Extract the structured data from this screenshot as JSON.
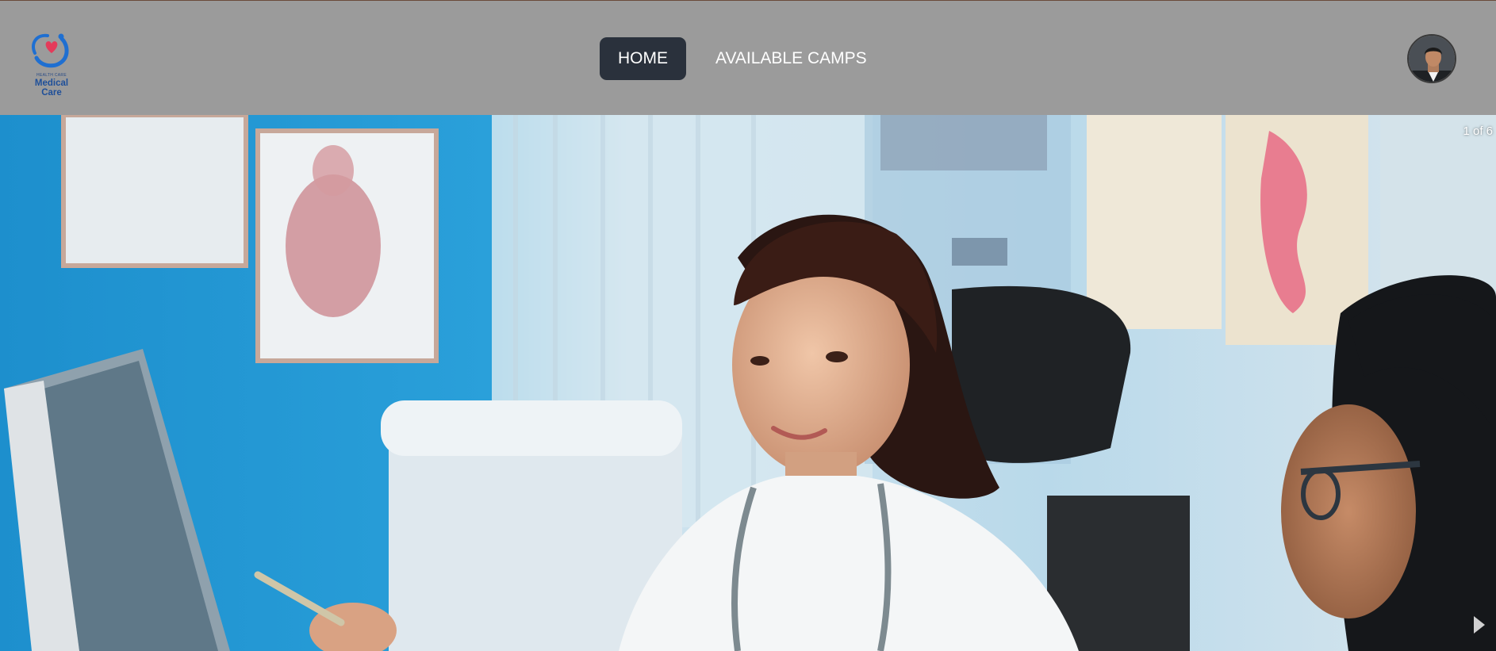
{
  "brand": {
    "tagline": "HEALTH CARE",
    "name": "Medical Care"
  },
  "nav": {
    "items": [
      {
        "label": "HOME",
        "active": true
      },
      {
        "label": "AVAILABLE CAMPS",
        "active": false
      }
    ]
  },
  "user": {
    "avatar_icon": "user-avatar"
  },
  "hero": {
    "counter": "1 of 6",
    "next_icon": "chevron-right-icon"
  },
  "colors": {
    "navbar_bg": "#9b9b9b",
    "active_nav_bg": "#2a313c",
    "logo_blue": "#1f6fd1"
  }
}
